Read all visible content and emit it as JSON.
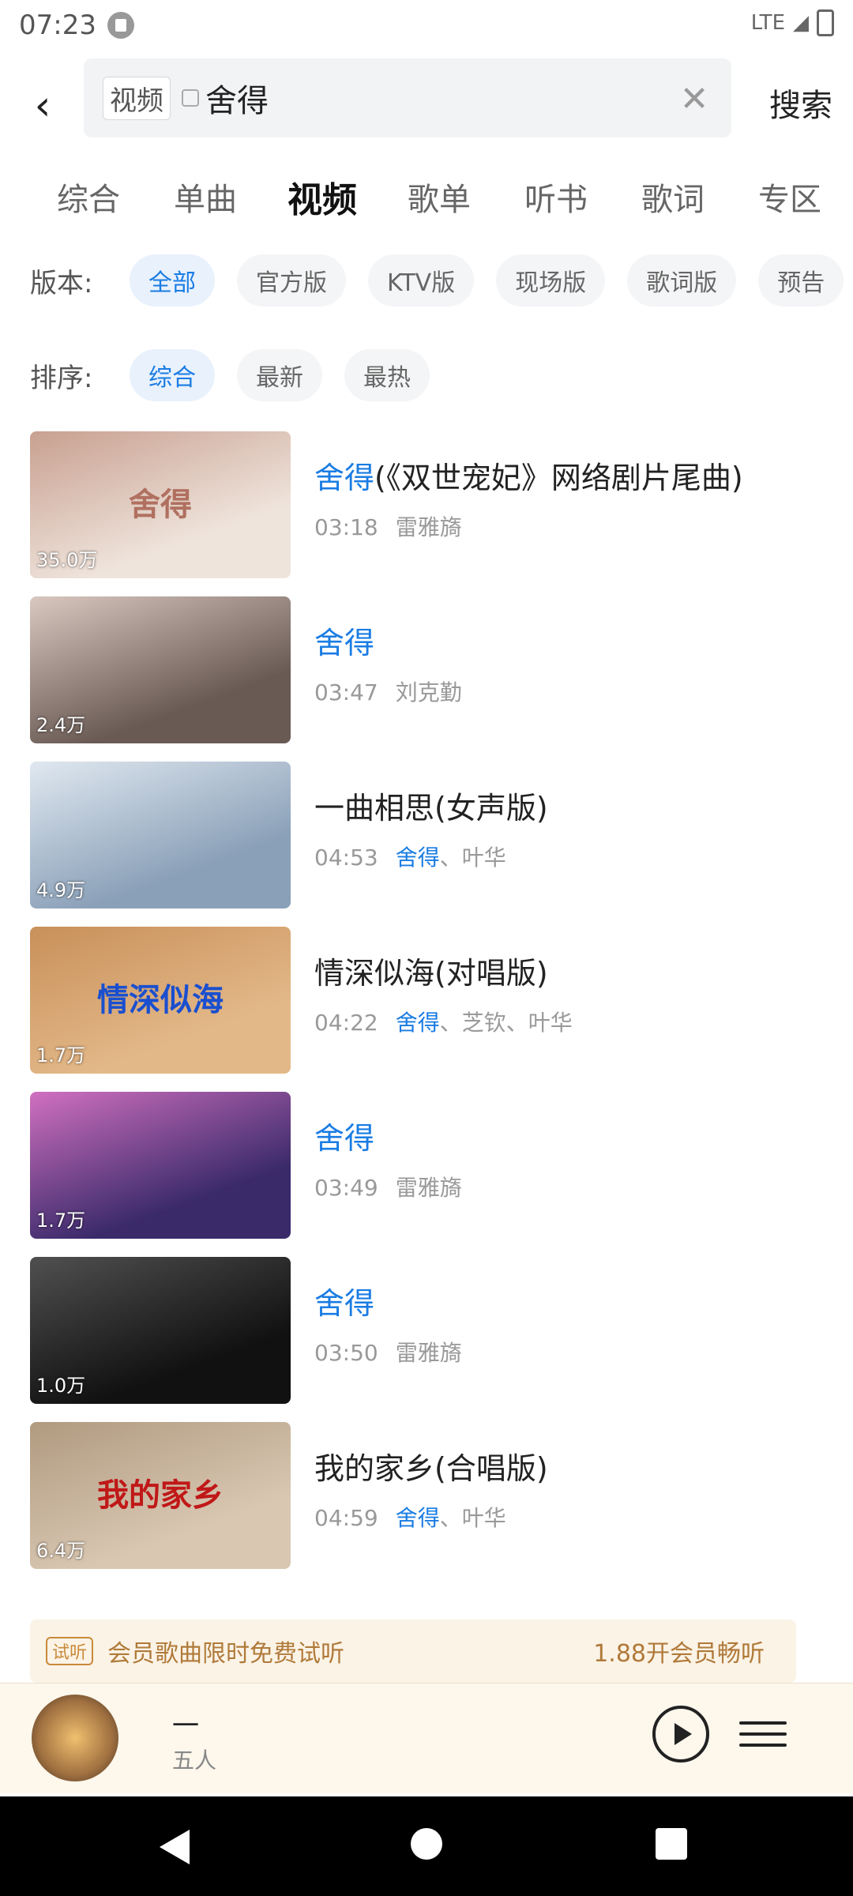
{
  "status_bar": {
    "time": "07:23",
    "network": "LTE"
  },
  "search": {
    "chip_label": "视频",
    "query": "舍得",
    "clear_icon": "close-icon",
    "submit_label": "搜索"
  },
  "tabs": [
    "综合",
    "单曲",
    "视频",
    "歌单",
    "听书",
    "歌词",
    "专区"
  ],
  "active_tab": "视频",
  "filters": {
    "version": {
      "label": "版本:",
      "options": [
        "全部",
        "官方版",
        "KTV版",
        "现场版",
        "歌词版",
        "预告"
      ],
      "selected": "全部"
    },
    "sort": {
      "label": "排序:",
      "options": [
        "综合",
        "最新",
        "最热"
      ],
      "selected": "综合"
    }
  },
  "results": [
    {
      "title_hl": "舍得",
      "title_rest": "(《双世宠妃》网络剧片尾曲)",
      "duration": "03:18",
      "artist_hl": "",
      "artist_rest": "雷雅旖",
      "plays": "35.0万"
    },
    {
      "title_hl": "舍得",
      "title_rest": "",
      "duration": "03:47",
      "artist_hl": "",
      "artist_rest": "刘克勤",
      "plays": "2.4万"
    },
    {
      "title_hl": "",
      "title_rest": "一曲相思(女声版)",
      "duration": "04:53",
      "artist_hl": "舍得",
      "artist_rest": "、叶华",
      "plays": "4.9万"
    },
    {
      "title_hl": "",
      "title_rest": "情深似海(对唱版)",
      "duration": "04:22",
      "artist_hl": "舍得",
      "artist_rest": "、芝钦、叶华",
      "plays": "1.7万"
    },
    {
      "title_hl": "舍得",
      "title_rest": "",
      "duration": "03:49",
      "artist_hl": "",
      "artist_rest": "雷雅旖",
      "plays": "1.7万"
    },
    {
      "title_hl": "舍得",
      "title_rest": "",
      "duration": "03:50",
      "artist_hl": "",
      "artist_rest": "雷雅旖",
      "plays": "1.0万"
    },
    {
      "title_hl": "",
      "title_rest": "我的家乡(合唱版)",
      "duration": "04:59",
      "artist_hl": "舍得",
      "artist_rest": "、叶华",
      "plays": "6.4万"
    }
  ],
  "thumbs": [
    {
      "bg": "#efe4dc",
      "accent": "#c8a090",
      "art_text": "舍得",
      "art_color": "#b07060"
    },
    {
      "bg": "#6a5a54",
      "accent": "#d8c8c0",
      "art_text": "",
      "art_color": "#ffffff"
    },
    {
      "bg": "#8aa0b8",
      "accent": "#e0e8f0",
      "art_text": "",
      "art_color": "#ffffff"
    },
    {
      "bg": "#e3b888",
      "accent": "#c8905a",
      "art_text": "情深似海",
      "art_color": "#1a4fcf"
    },
    {
      "bg": "#3a2a6a",
      "accent": "#d070c0",
      "art_text": "",
      "art_color": "#ffffff"
    },
    {
      "bg": "#111111",
      "accent": "#505050",
      "art_text": "",
      "art_color": "#ffffff"
    },
    {
      "bg": "#d9c7b2",
      "accent": "#b09a80",
      "art_text": "我的家乡",
      "art_color": "#c01818"
    }
  ],
  "vip_banner": {
    "tag": "试听",
    "text": "会员歌曲限时免费试听",
    "cta": "1.88开会员畅听"
  },
  "player": {
    "title": "一",
    "artist": "五人"
  }
}
